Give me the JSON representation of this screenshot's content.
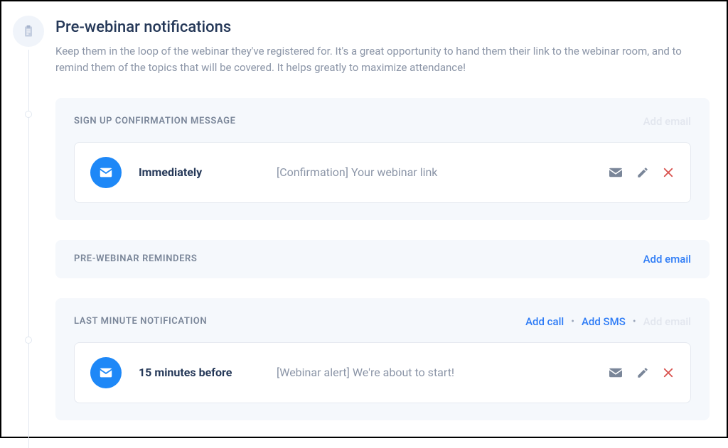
{
  "header": {
    "title": "Pre-webinar notifications",
    "description": "Keep them in the loop of the webinar they've registered for. It's a great opportunity to hand them their link to the webinar room, and to remind them of the topics that will be covered. It helps greatly to maximize attendance!"
  },
  "sections": {
    "confirmation": {
      "title": "SIGN UP CONFIRMATION MESSAGE",
      "add_email_label": "Add email",
      "card": {
        "timing": "Immediately",
        "subject": "[Confirmation] Your webinar link"
      }
    },
    "reminders": {
      "title": "PRE-WEBINAR REMINDERS",
      "add_email_label": "Add email"
    },
    "last_minute": {
      "title": "LAST MINUTE NOTIFICATION",
      "add_call_label": "Add call",
      "add_sms_label": "Add SMS",
      "add_email_label": "Add email",
      "card": {
        "timing": "15 minutes before",
        "subject": "[Webinar alert] We're about to start!"
      }
    }
  },
  "colors": {
    "accent": "#1e88f7",
    "link": "#2e7cf6",
    "danger": "#d9534f",
    "muted": "#8b95a7"
  }
}
